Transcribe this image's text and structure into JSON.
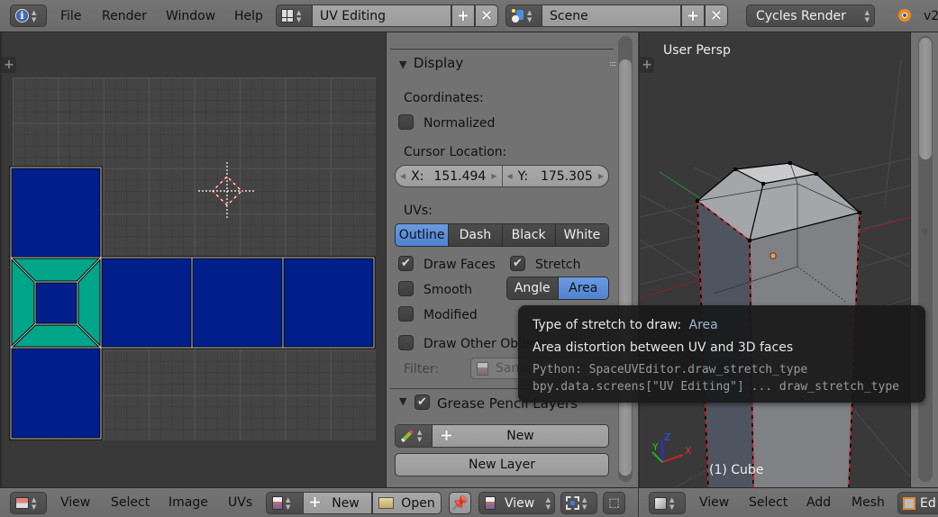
{
  "top_bar": {
    "menus": [
      "File",
      "Render",
      "Window",
      "Help"
    ],
    "screen_layout": "UV Editing",
    "scene": "Scene",
    "render_engine": "Cycles Render",
    "version_text": "v2"
  },
  "uv_editor": {
    "header_menus": [
      "View",
      "Select",
      "Image",
      "UVs"
    ],
    "new_label": "New",
    "open_label": "Open",
    "view_dropdown": "View",
    "colors": {
      "face": "#001f8a",
      "selected_face": "#00a58a",
      "grid": "#444444"
    }
  },
  "properties": {
    "display_panel": {
      "title": "Display",
      "coordinates_label": "Coordinates:",
      "normalized_label": "Normalized",
      "normalized_checked": false,
      "cursor_location_label": "Cursor Location:",
      "cursor_x_label": "X:",
      "cursor_x": "151.494",
      "cursor_y_label": "Y:",
      "cursor_y": "175.305",
      "uvs_label": "UVs:",
      "uv_styles": [
        "Outline",
        "Dash",
        "Black",
        "White"
      ],
      "uv_style_selected": "Outline",
      "draw_faces_label": "Draw Faces",
      "draw_faces_checked": true,
      "stretch_label": "Stretch",
      "stretch_checked": true,
      "smooth_label": "Smooth",
      "smooth_checked": false,
      "stretch_types": [
        "Angle",
        "Area"
      ],
      "stretch_type_selected": "Area",
      "modified_label": "Modified",
      "modified_checked": false,
      "draw_other_label": "Draw Other Objects",
      "draw_other_checked": false,
      "filter_label": "Filter:",
      "filter_value": "Same Image"
    },
    "grease_pencil_panel": {
      "title": "Grease Pencil Layers",
      "enabled": true,
      "new_label": "New",
      "new_layer_label": "New Layer"
    }
  },
  "viewport": {
    "view_label": "User Persp",
    "object_label": "(1) Cube",
    "header_menus": [
      "View",
      "Select",
      "Add",
      "Mesh"
    ],
    "mode_label": "Ed",
    "axis_labels": {
      "x": "X",
      "y": "Y",
      "z": "Z"
    }
  },
  "tooltip": {
    "title": "Type of stretch to draw:",
    "value": "Area",
    "description": "Area distortion between UV and 3D faces",
    "python_line1": "Python: SpaceUVEditor.draw_stretch_type",
    "python_line2": "bpy.data.screens[\"UV Editing\"] ... draw_stretch_type"
  }
}
